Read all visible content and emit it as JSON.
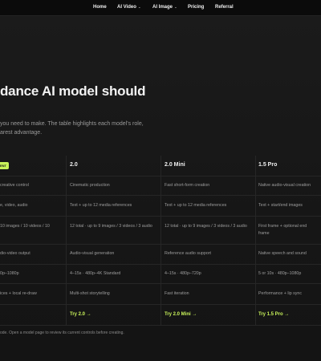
{
  "nav": {
    "items": [
      {
        "label": "Home",
        "has_dropdown": false
      },
      {
        "label": "AI Video",
        "has_dropdown": true
      },
      {
        "label": "AI Image",
        "has_dropdown": true
      },
      {
        "label": "Pricing",
        "has_dropdown": false
      },
      {
        "label": "Referral",
        "has_dropdown": false
      }
    ],
    "dropdown_icon": "chevron-down-icon"
  },
  "hero": {
    "headline": "dance AI model should",
    "subtitle_line1": "you need to make. The table highlights each model's role,",
    "subtitle_line2": "arest advantage."
  },
  "table": {
    "badge": "ENT",
    "columns": [
      "2.0",
      "2.0 Mini",
      "1.5 Pro"
    ],
    "first_col": [
      "creative control",
      "e, video, audio",
      "10 images / 10 videos / 10",
      "dio-video output",
      "0p–1080p",
      "ices + local re-draw"
    ],
    "rows": [
      [
        "Cinematic production",
        "Fast short-form creation",
        "Native audio-visual creation"
      ],
      [
        "Text + up to 12 media references",
        "Text + up to 12 media references",
        "Text + start/end images"
      ],
      [
        "12 total · up to 9 images / 3 videos / 3 audio",
        "12 total · up to 9 images / 3 videos / 3 audio",
        "First frame + optional end frame"
      ],
      [
        "Audio-visual generation",
        "Reference audio support",
        "Native speech and sound"
      ],
      [
        "4–15s · 480p–4K Standard",
        "4–15s · 480p–720p",
        "5 or 10s · 480p–1080p"
      ],
      [
        "Multi-shot storytelling",
        "Fast iteration",
        "Performance + lip sync"
      ]
    ],
    "try_buttons": [
      "Try 2.0",
      "Try 2.0 Mini",
      "Try 1.5 Pro"
    ],
    "try_arrow": "→"
  },
  "footnote": "ode. Open a model page to review its current controls before creating.",
  "colors": {
    "accent": "#c8f25a",
    "background": "#141414",
    "nav_bg": "#0b0b0b"
  }
}
